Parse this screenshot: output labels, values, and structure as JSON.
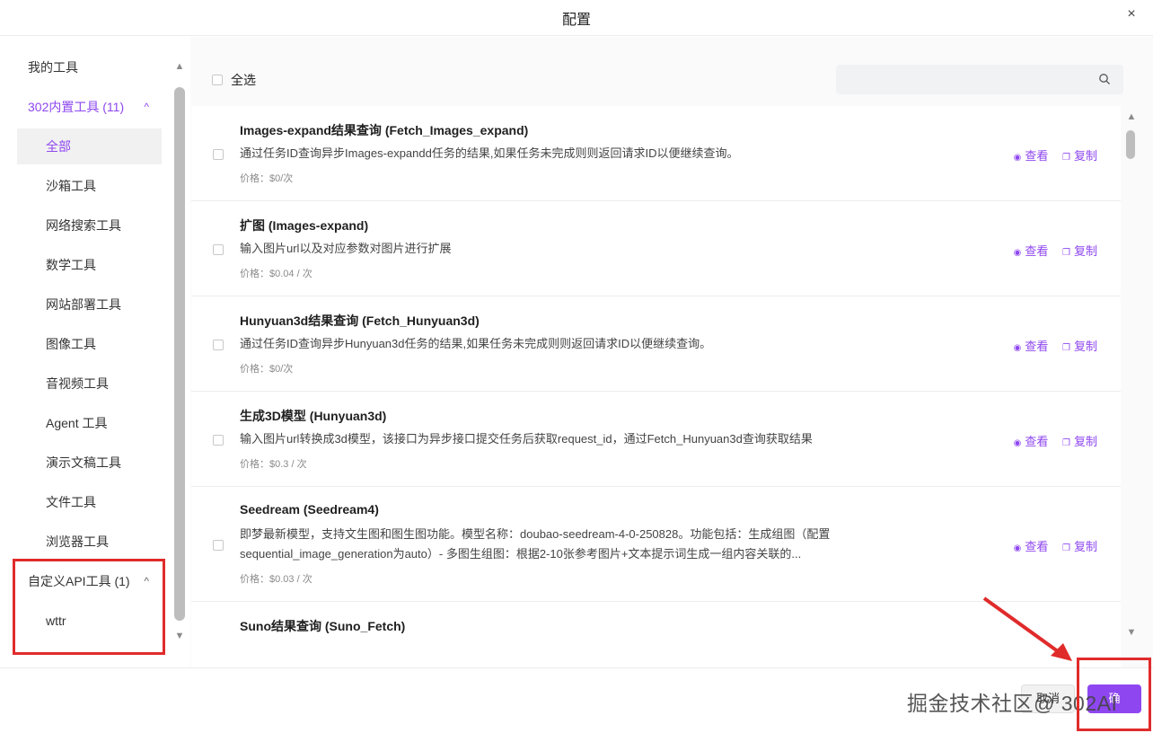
{
  "dialog": {
    "title": "配置",
    "close_glyph": "×"
  },
  "sidebar": {
    "my_tools": "我的工具",
    "builtin_group": {
      "label": "302内置工具 (11)",
      "chevron": "^"
    },
    "items": [
      "全部",
      "沙箱工具",
      "网络搜索工具",
      "数学工具",
      "网站部署工具",
      "图像工具",
      "音视频工具",
      "Agent 工具",
      "演示文稿工具",
      "文件工具",
      "浏览器工具"
    ],
    "custom_group": {
      "label": "自定义API工具 (1)",
      "chevron": "^"
    },
    "custom_items": [
      "wttr"
    ],
    "scroll": {
      "up": "▲",
      "down": "▼"
    }
  },
  "main": {
    "select_all": "全选",
    "search": {
      "placeholder": "",
      "icon": "search-icon"
    },
    "actions": {
      "view": "查看",
      "copy": "复制",
      "view_icon": "eye-icon",
      "copy_icon": "copy-icon"
    },
    "tools": [
      {
        "name": "Images-expand结果查询 (Fetch_Images_expand)",
        "desc": "通过任务ID查询异步Images-expandd任务的结果,如果任务未完成则则返回请求ID以便继续查询。",
        "price": "价格：$0/次"
      },
      {
        "name": "扩图 (Images-expand)",
        "desc": "输入图片url以及对应参数对图片进行扩展",
        "price": "价格：$0.04 / 次"
      },
      {
        "name": "Hunyuan3d结果查询 (Fetch_Hunyuan3d)",
        "desc": "通过任务ID查询异步Hunyuan3d任务的结果,如果任务未完成则则返回请求ID以便继续查询。",
        "price": "价格：$0/次"
      },
      {
        "name": "生成3D模型 (Hunyuan3d)",
        "desc": "输入图片url转换成3d模型，该接口为异步接口提交任务后获取request_id，通过Fetch_Hunyuan3d查询获取结果",
        "price": "价格：$0.3 / 次"
      },
      {
        "name": "Seedream (Seedream4)",
        "desc": "即梦最新模型，支持文生图和图生图功能。模型名称：doubao-seedream-4-0-250828。功能包括：生成组图（配置sequential_image_generation为auto）- 多图生组图：根据2-10张参考图片+文本提示词生成一组内容关联的...",
        "price": "价格：$0.03 / 次"
      },
      {
        "name": "Suno结果查询 (Suno_Fetch)",
        "desc": "",
        "price": ""
      }
    ]
  },
  "footer": {
    "cancel": "取消",
    "confirm": "确",
    "watermark": "掘金技术社区@ 302AI"
  },
  "colors": {
    "accent": "#8e47f0",
    "annotation": "#e02b2b"
  }
}
